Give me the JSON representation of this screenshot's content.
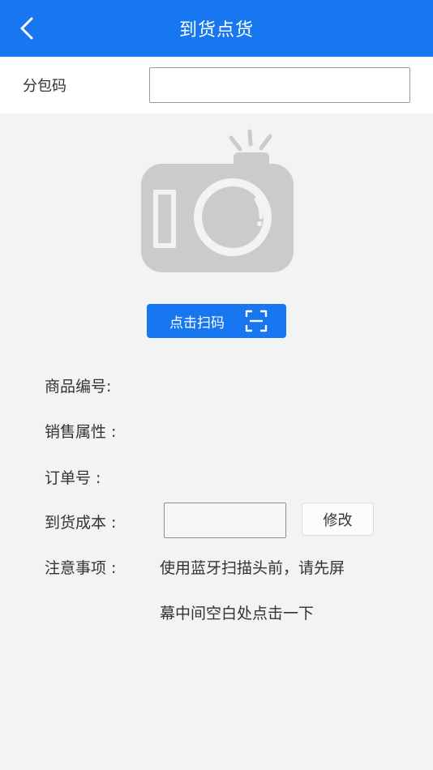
{
  "header": {
    "title": "到货点货"
  },
  "package": {
    "label": "分包码",
    "value": "",
    "placeholder": ""
  },
  "scan": {
    "button_label": "点击扫码"
  },
  "fields": {
    "product_code_label": "商品编号:",
    "sales_attr_label": "销售属性 :",
    "order_no_label": "订单号 :",
    "arrival_cost_label": "到货成本 :",
    "notes_label": "注意事项 :"
  },
  "cost": {
    "value": ""
  },
  "edit": {
    "label": "修改"
  },
  "notes": {
    "line1": "使用蓝牙扫描头前，请先屏",
    "line2": "幕中间空白处点击一下"
  },
  "colors": {
    "primary": "#1677f0",
    "background": "#f2f3f5",
    "camera_gray": "#cbcbcb"
  },
  "icons": [
    "back-arrow-icon",
    "camera-icon",
    "scan-frame-icon"
  ]
}
